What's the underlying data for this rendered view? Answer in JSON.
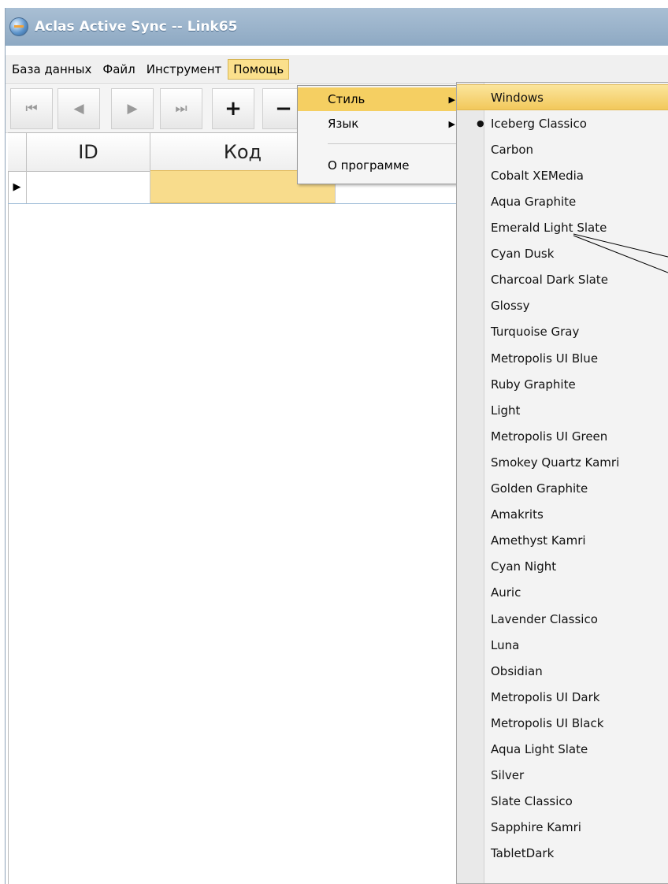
{
  "window": {
    "title": "Aclas Active Sync -- Link65"
  },
  "menubar": {
    "items": [
      "База данных",
      "Файл",
      "Инструмент",
      "Помощь"
    ],
    "active": "Помощь"
  },
  "toolbar": {
    "buttons": [
      {
        "icon": "first-record-icon",
        "glyph": "⏮"
      },
      {
        "icon": "prev-record-icon",
        "glyph": "◀"
      },
      {
        "icon": "next-record-icon",
        "glyph": "▶"
      },
      {
        "icon": "last-record-icon",
        "glyph": "⏭"
      },
      {
        "icon": "add-record-icon",
        "glyph": "+"
      },
      {
        "icon": "delete-record-icon",
        "glyph": "−"
      }
    ]
  },
  "grid": {
    "columns": [
      "ID",
      "Код"
    ],
    "row_indicator": "▶"
  },
  "help_menu": {
    "items": [
      {
        "label": "Стиль",
        "arrow": "▶"
      },
      {
        "label": "Язык",
        "arrow": "▶"
      },
      {
        "label": "О программе",
        "arrow": ""
      }
    ],
    "highlighted": "Стиль"
  },
  "style_menu": {
    "highlighted": "Windows",
    "checked": "Iceberg Classico",
    "bullet": "●",
    "items": [
      "Windows",
      "Iceberg Classico",
      "Carbon",
      "Cobalt XEMedia",
      "Aqua Graphite",
      "Emerald Light Slate",
      "Cyan Dusk",
      "Charcoal Dark Slate",
      "Glossy",
      "Turquoise Gray",
      "Metropolis UI Blue",
      "Ruby Graphite",
      "Light",
      "Metropolis UI Green",
      "Smokey Quartz Kamri",
      "Golden Graphite",
      "Amakrits",
      "Amethyst Kamri",
      "Cyan Night",
      "Auric",
      "Lavender Classico",
      "Luna",
      "Obsidian",
      "Metropolis UI Dark",
      "Metropolis UI Black",
      "Aqua Light Slate",
      "Silver",
      "Slate Classico",
      "Sapphire Kamri",
      "TabletDark"
    ]
  },
  "colors": {
    "titlebar": "#8ea9c3",
    "highlight": "#f5cf62",
    "selected_cell": "#f8dc8c"
  }
}
